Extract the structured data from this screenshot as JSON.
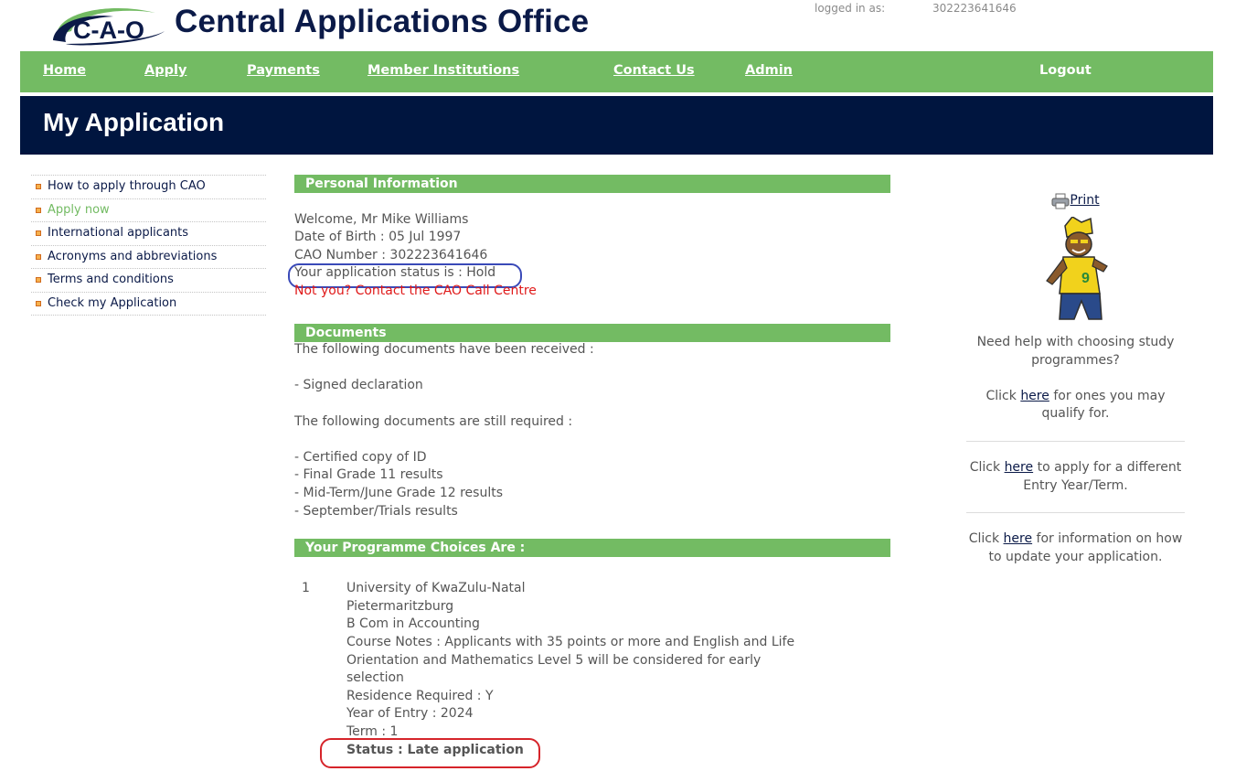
{
  "header": {
    "logo_text": "C-A-O",
    "site_title": "Central Applications Office",
    "login_label": "logged in as:",
    "login_value": "302223641646"
  },
  "nav": {
    "home": "Home",
    "apply": "Apply",
    "payments": "Payments",
    "member_institutions": "Member Institutions",
    "contact_us": "Contact Us",
    "admin": "Admin",
    "logout": "Logout"
  },
  "banner": {
    "title": "My Application"
  },
  "sidebar": {
    "items": [
      {
        "label": "How to apply through CAO"
      },
      {
        "label": "Apply now"
      },
      {
        "label": "International applicants"
      },
      {
        "label": "Acronyms and abbreviations"
      },
      {
        "label": "Terms and conditions"
      },
      {
        "label": "Check my Application"
      }
    ]
  },
  "personal": {
    "heading": "Personal Information",
    "welcome": "Welcome, Mr Mike Williams",
    "dob": "Date of Birth : 05 Jul 1997",
    "cao_number": "CAO Number : 302223641646",
    "status": "Your application status is : Hold",
    "not_you": "Not you? Contact the CAO Call Centre"
  },
  "documents": {
    "heading": "Documents",
    "received_intro": "The following documents have been received :",
    "received": [
      "- Signed declaration"
    ],
    "required_intro": "The following documents are still required :",
    "required": [
      "- Certified copy of ID",
      "- Final Grade 11 results",
      "- Mid-Term/June Grade 12 results",
      "- September/Trials results"
    ]
  },
  "choices": {
    "heading": "Your Programme Choices Are :",
    "items": [
      {
        "number": "1",
        "institution": "University of KwaZulu-Natal",
        "campus": "Pietermaritzburg",
        "programme": "B Com in Accounting",
        "notes_line1": "Course Notes : Applicants with 35 points or more and English and Life",
        "notes_line2": "Orientation and Mathematics Level 5 will be considered for early",
        "notes_line3": "selection",
        "residence": "Residence Required : Y",
        "year": "Year of Entry : 2024",
        "term": "Term : 1",
        "status": "Status : Late application"
      }
    ]
  },
  "right": {
    "print": "Print",
    "help_line1": "Need help with choosing study",
    "help_line2": "programmes?",
    "click": "Click",
    "here": "here",
    "qualify_rest1": "for ones you may",
    "qualify_rest2": "qualify for.",
    "different_rest1": "to apply for a different",
    "different_rest2": "Entry Year/Term.",
    "update_rest1": "for information on how",
    "update_rest2": "to update your application."
  },
  "colors": {
    "green": "#73bb63",
    "navy": "#00153f",
    "red": "#e01a1a",
    "oval_blue": "#3a4ab8",
    "oval_red": "#d6242a"
  }
}
